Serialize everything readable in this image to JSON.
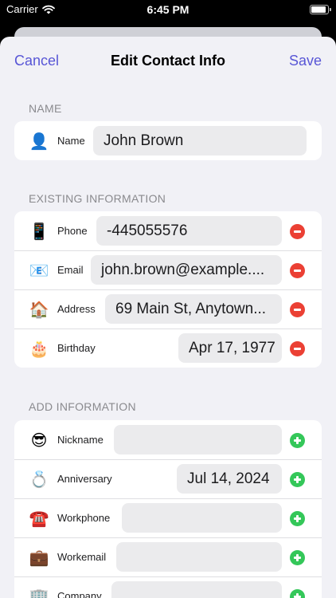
{
  "status_bar": {
    "carrier": "Carrier",
    "time": "6:45 PM"
  },
  "nav": {
    "cancel": "Cancel",
    "title": "Edit Contact Info",
    "save": "Save"
  },
  "name_section": {
    "header": "NAME",
    "row": {
      "icon": "👤",
      "label": "Name",
      "value": "John Brown"
    }
  },
  "existing_section": {
    "header": "EXISTING INFORMATION",
    "rows": [
      {
        "icon": "📱",
        "label": "Phone",
        "value": "-445055576"
      },
      {
        "icon": "📧",
        "label": "Email",
        "value": "john.brown@example...."
      },
      {
        "icon": "🏠",
        "label": "Address",
        "value": "69 Main St, Anytown..."
      },
      {
        "icon": "🎂",
        "label": "Birthday",
        "value": "Apr 17, 1977"
      }
    ]
  },
  "add_section": {
    "header": "ADD INFORMATION",
    "rows": [
      {
        "icon": "😎",
        "label": "Nickname",
        "value": ""
      },
      {
        "icon": "💍",
        "label": "Anniversary",
        "value": "Jul 14, 2024"
      },
      {
        "icon": "☎️",
        "label": "Workphone",
        "value": ""
      },
      {
        "icon": "💼",
        "label": "Workemail",
        "value": ""
      },
      {
        "icon": "🏢",
        "label": "Company",
        "value": ""
      }
    ]
  },
  "colors": {
    "accent": "#5856d6",
    "remove": "#eb4034",
    "add": "#34c759",
    "background": "#f1f1f6"
  }
}
